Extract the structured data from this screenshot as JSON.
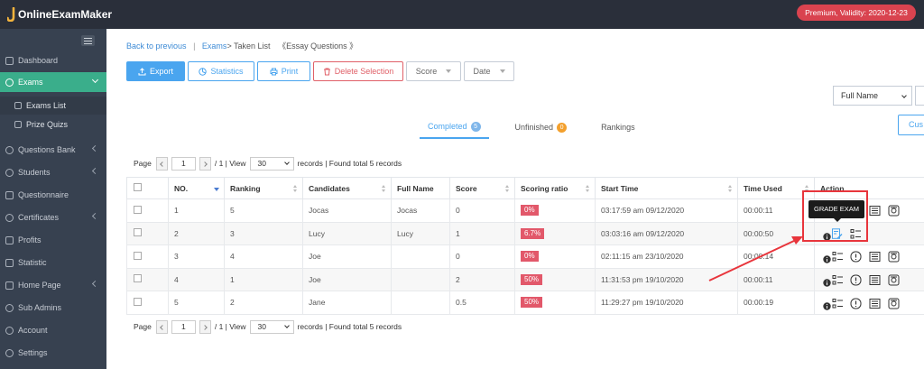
{
  "brand": {
    "name": "OnlineExamMaker"
  },
  "premium": {
    "label": "Premium, Validity: 2020-12-23"
  },
  "sidebar": {
    "items": [
      {
        "label": "Dashboard"
      },
      {
        "label": "Exams"
      },
      {
        "label": "Exams List"
      },
      {
        "label": "Prize Quizs"
      },
      {
        "label": "Questions Bank"
      },
      {
        "label": "Students"
      },
      {
        "label": "Questionnaire"
      },
      {
        "label": "Certificates"
      },
      {
        "label": "Profits"
      },
      {
        "label": "Statistic"
      },
      {
        "label": "Home Page"
      },
      {
        "label": "Sub Admins"
      },
      {
        "label": "Account"
      },
      {
        "label": "Settings"
      }
    ]
  },
  "breadcrumb": {
    "back": "Back to previous",
    "sep": "|",
    "exams": "Exams",
    "taken": "> Taken List",
    "current": "《Essay Questions 》"
  },
  "toolbar": {
    "export": "Export",
    "statistics": "Statistics",
    "print": "Print",
    "delete": "Delete Selection",
    "score": "Score",
    "date": "Date"
  },
  "filter": {
    "fullname": "Full Name",
    "cus": "Cus"
  },
  "tabs": [
    {
      "label": "Completed",
      "count": "5"
    },
    {
      "label": "Unfinished",
      "count": "0"
    },
    {
      "label": "Rankings"
    }
  ],
  "pager": {
    "page_label": "Page",
    "page": "1",
    "total_pages": "/ 1 | View",
    "per_page": "30",
    "records": "records | Found total 5 records"
  },
  "table": {
    "headers": [
      "NO.",
      "Ranking",
      "Candidates",
      "Full Name",
      "Score",
      "Scoring ratio",
      "Start Time",
      "Time Used",
      "Action"
    ],
    "rows": [
      {
        "no": "1",
        "ranking": "5",
        "candidate": "Jocas",
        "fullname": "Jocas",
        "score": "0",
        "ratio": "0%",
        "start": "03:17:59 am 09/12/2020",
        "used": "00:00:11"
      },
      {
        "no": "2",
        "ranking": "3",
        "candidate": "Lucy",
        "fullname": "Lucy",
        "score": "1",
        "ratio": "6.7%",
        "start": "03:03:16 am 09/12/2020",
        "used": "00:00:50"
      },
      {
        "no": "3",
        "ranking": "4",
        "candidate": "Joe",
        "fullname": "",
        "score": "0",
        "ratio": "0%",
        "start": "02:11:15 am 23/10/2020",
        "used": "00:00:14"
      },
      {
        "no": "4",
        "ranking": "1",
        "candidate": "Joe",
        "fullname": "",
        "score": "2",
        "ratio": "50%",
        "start": "11:31:53 pm 19/10/2020",
        "used": "00:00:11"
      },
      {
        "no": "5",
        "ranking": "2",
        "candidate": "Jane",
        "fullname": "",
        "score": "0.5",
        "ratio": "50%",
        "start": "11:29:27 pm 19/10/2020",
        "used": "00:00:19"
      }
    ]
  },
  "tooltip": {
    "label": "GRADE EXAM"
  },
  "colors": {
    "accent": "#4aa5ef",
    "sidebar": "#374150",
    "active": "#3aae8b",
    "danger": "#e2586a"
  }
}
